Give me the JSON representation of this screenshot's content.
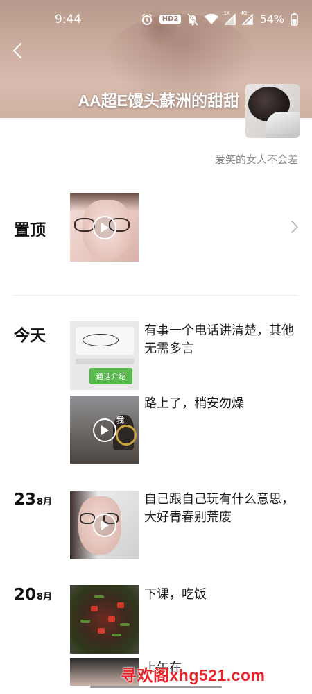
{
  "status_bar": {
    "time": "9:44",
    "hd_badge": "HD2",
    "network_label": "1X",
    "network_label_2": "4G",
    "battery": "54%"
  },
  "profile": {
    "name": "AA超E馒头蘇洲的甜甜",
    "signature": "爱笑的女人不会差"
  },
  "pinned": {
    "label": "置顶"
  },
  "today": {
    "label": "今天",
    "posts": [
      {
        "text": "有事一个电话讲清楚，其他无需多言",
        "thumb_caption": "通话介绍"
      },
      {
        "text": "路上了，稍安勿燥",
        "thumb_caption": "我"
      }
    ]
  },
  "dated": [
    {
      "day": "23",
      "month": "8月",
      "text": "自己跟自己玩有什么意思，大好青春别荒废"
    },
    {
      "day": "20",
      "month": "8月",
      "text": "下课，吃饭",
      "next_text": "上午在"
    }
  ],
  "watermark": "寻欢阁xhg521.com",
  "colors": {
    "accent_green": "#57b94c",
    "watermark_red": "#e8262a"
  }
}
